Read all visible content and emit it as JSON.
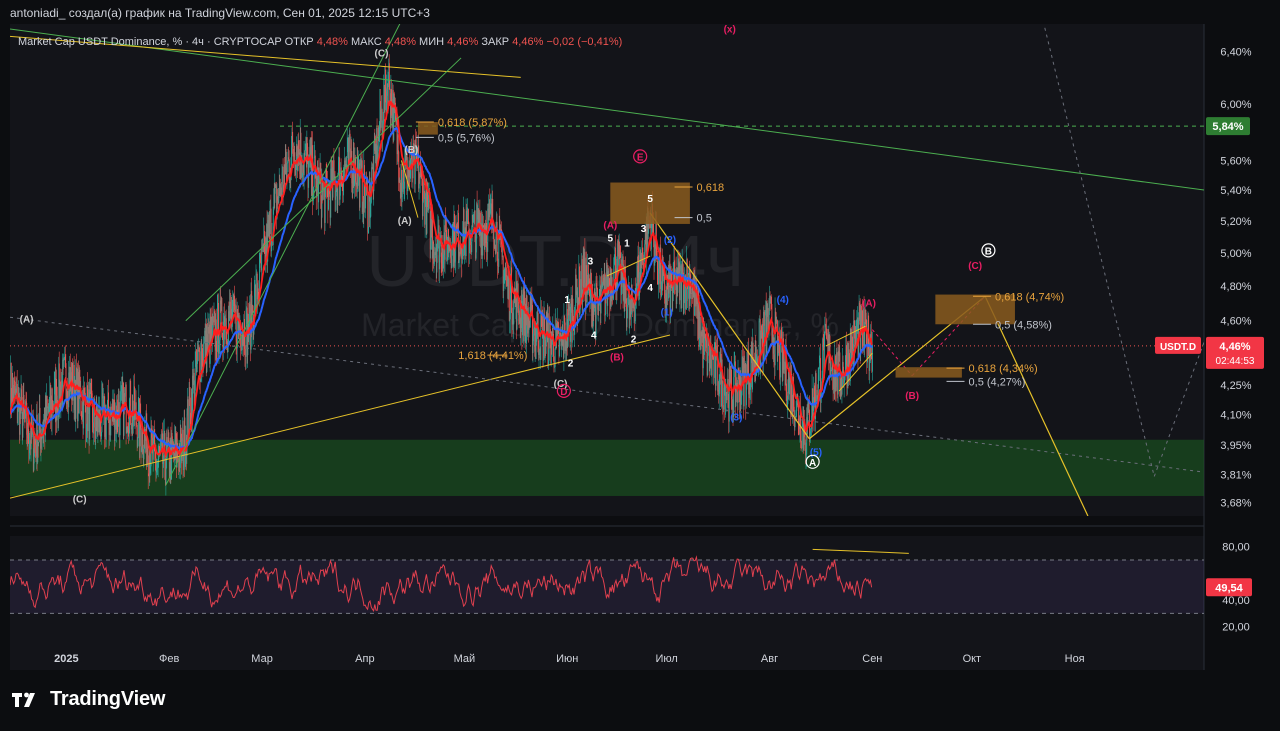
{
  "header": "antoniadi_ создал(а) график на TradingView.com, Сен 01, 2025 12:15 UTC+3",
  "legend": {
    "symbol": "Market Cap USDT Dominance, %",
    "interval": "4ч",
    "exchange": "CRYPTOCAP",
    "open_label": "ОТКР",
    "open": "4,48%",
    "high_label": "МАКС",
    "high": "4,48%",
    "low_label": "МИН",
    "low": "4,46%",
    "close_label": "ЗАКР",
    "close": "4,46%",
    "change": "−0,02 (−0,41%)"
  },
  "watermark": {
    "main": "USDT.D, 4ч",
    "sub": "Market Cap USDT Dominance, %"
  },
  "brand": "TradingView",
  "colors": {
    "background": "#0c0d10",
    "candle_up": "#26a69a",
    "candle_down": "#ef5350",
    "ema_fast": "#ff1e1e",
    "ema_slow": "#2962ff",
    "trendline": "#4caf50",
    "wave_line": "#e6c229",
    "fib_box": "#8a5a1e",
    "demand_zone": "#1b5e20",
    "rsi_line": "#e0404f",
    "price_tag": "#f23645",
    "level_tag": "#2e7d32"
  },
  "chart_data": [
    {
      "type": "candlestick",
      "title": "Market Cap USDT Dominance, %",
      "ylabel": "%",
      "y_scale": "log",
      "ylim": [
        3.62,
        6.62
      ],
      "y_ticks": [
        "6,40%",
        "6,00%",
        "5,60%",
        "5,40%",
        "5,20%",
        "5,00%",
        "4,80%",
        "4,60%",
        "4,25%",
        "4,10%",
        "3,95%",
        "3,81%",
        "3,68%"
      ],
      "x_ticks": [
        "2025",
        "Фев",
        "Мар",
        "Апр",
        "Май",
        "Июн",
        "Июл",
        "Авг",
        "Сен",
        "Окт",
        "Ноя"
      ],
      "x_dates": [
        "2025-01-01",
        "2025-02-01",
        "2025-03-01",
        "2025-04-01",
        "2025-05-01",
        "2025-06-01",
        "2025-07-01",
        "2025-08-01",
        "2025-09-01",
        "2025-10-01",
        "2025-11-01"
      ],
      "x_range": [
        "2024-12-15",
        "2025-12-10"
      ],
      "price_path": [
        [
          "2024-12-15",
          4.25
        ],
        [
          "2024-12-22",
          3.95
        ],
        [
          "2025-01-01",
          4.3
        ],
        [
          "2025-01-10",
          4.05
        ],
        [
          "2025-01-20",
          4.15
        ],
        [
          "2025-01-28",
          3.86
        ],
        [
          "2025-02-05",
          3.92
        ],
        [
          "2025-02-10",
          4.4
        ],
        [
          "2025-02-18",
          4.62
        ],
        [
          "2025-02-25",
          4.55
        ],
        [
          "2025-03-05",
          5.3
        ],
        [
          "2025-03-11",
          5.72
        ],
        [
          "2025-03-20",
          5.35
        ],
        [
          "2025-03-28",
          5.62
        ],
        [
          "2025-04-02",
          5.3
        ],
        [
          "2025-04-08",
          6.2
        ],
        [
          "2025-04-12",
          5.5
        ],
        [
          "2025-04-17",
          5.55
        ],
        [
          "2025-04-22",
          5.05
        ],
        [
          "2025-04-30",
          5.1
        ],
        [
          "2025-05-10",
          5.2
        ],
        [
          "2025-05-14",
          4.78
        ],
        [
          "2025-05-22",
          4.55
        ],
        [
          "2025-05-30",
          4.45
        ],
        [
          "2025-06-06",
          4.85
        ],
        [
          "2025-06-10",
          4.65
        ],
        [
          "2025-06-16",
          4.95
        ],
        [
          "2025-06-20",
          4.62
        ],
        [
          "2025-06-26",
          5.22
        ],
        [
          "2025-06-30",
          4.75
        ],
        [
          "2025-07-08",
          4.85
        ],
        [
          "2025-07-12",
          4.45
        ],
        [
          "2025-07-20",
          4.2
        ],
        [
          "2025-07-26",
          4.32
        ],
        [
          "2025-08-01",
          4.6
        ],
        [
          "2025-08-06",
          4.3
        ],
        [
          "2025-08-12",
          4.0
        ],
        [
          "2025-08-18",
          4.45
        ],
        [
          "2025-08-22",
          4.28
        ],
        [
          "2025-08-28",
          4.55
        ],
        [
          "2025-09-01",
          4.46
        ]
      ],
      "overlays": [
        {
          "name": "EMA fast",
          "color": "#ff1e1e"
        },
        {
          "name": "EMA slow",
          "color": "#2962ff"
        }
      ],
      "horizontal_levels": [
        {
          "value": 5.84,
          "label": "5,84%",
          "style": "dashed-green"
        },
        {
          "value": 4.46,
          "label": "4,46%",
          "style": "dashed-red"
        }
      ],
      "fib_levels": [
        {
          "label": "0,618 (5,87%)",
          "value": 5.87
        },
        {
          "label": "0,5 (5,76%)",
          "value": 5.76
        },
        {
          "label": "0,618",
          "value": 5.42
        },
        {
          "label": "0,5",
          "value": 5.22
        },
        {
          "label": "1,618 (4,41%)",
          "value": 4.41
        },
        {
          "label": "0,618 (4,74%)",
          "value": 4.74
        },
        {
          "label": "0,5 (4,58%)",
          "value": 4.58
        },
        {
          "label": "0,618 (4,34%)",
          "value": 4.34
        },
        {
          "label": "0,5 (4,27%)",
          "value": 4.27
        }
      ],
      "demand_zone": [
        3.71,
        3.975
      ],
      "last_price_tag": {
        "symbol": "USDT.D",
        "price": "4,46%",
        "countdown": "02:44:53"
      },
      "wave_labels": [
        {
          "text": "(A)",
          "date": "2024-12-20",
          "y": 4.59,
          "color": "#cccccc"
        },
        {
          "text": "(C)",
          "date": "2025-01-05",
          "y": 3.68,
          "color": "#cccccc"
        },
        {
          "text": "(C)",
          "date": "2025-04-06",
          "y": 6.36,
          "color": "#cccccc"
        },
        {
          "text": "(B)",
          "date": "2025-04-15",
          "y": 5.65,
          "color": "#cccccc"
        },
        {
          "text": "(A)",
          "date": "2025-04-13",
          "y": 5.18,
          "color": "#cccccc"
        },
        {
          "text": "(x)",
          "date": "2025-07-20",
          "y": 6.55,
          "color": "#e91e63"
        },
        {
          "text": "E",
          "date": "2025-06-23",
          "y": 5.6,
          "color": "#e91e63"
        },
        {
          "text": "5",
          "date": "2025-06-26",
          "y": 5.32,
          "color": "#ffffff"
        },
        {
          "text": "(A)",
          "date": "2025-06-14",
          "y": 5.15,
          "color": "#e91e63"
        },
        {
          "text": "5",
          "date": "2025-06-14",
          "y": 5.07,
          "color": "#ffffff"
        },
        {
          "text": "1",
          "date": "2025-06-19",
          "y": 5.04,
          "color": "#ffffff"
        },
        {
          "text": "3",
          "date": "2025-06-24",
          "y": 5.13,
          "color": "#ffffff"
        },
        {
          "text": "3",
          "date": "2025-06-08",
          "y": 4.93,
          "color": "#ffffff"
        },
        {
          "text": "1",
          "date": "2025-06-01",
          "y": 4.7,
          "color": "#ffffff"
        },
        {
          "text": "4",
          "date": "2025-06-09",
          "y": 4.5,
          "color": "#ffffff"
        },
        {
          "text": "4",
          "date": "2025-06-26",
          "y": 4.77,
          "color": "#ffffff"
        },
        {
          "text": "2",
          "date": "2025-06-21",
          "y": 4.48,
          "color": "#ffffff"
        },
        {
          "text": "2",
          "date": "2025-06-02",
          "y": 4.35,
          "color": "#ffffff"
        },
        {
          "text": "(2)",
          "date": "2025-07-02",
          "y": 5.06,
          "color": "#2962ff"
        },
        {
          "text": "(1)",
          "date": "2025-07-01",
          "y": 4.63,
          "color": "#2962ff"
        },
        {
          "text": "(B)",
          "date": "2025-06-16",
          "y": 4.38,
          "color": "#e91e63"
        },
        {
          "text": "(C)",
          "date": "2025-05-30",
          "y": 4.24,
          "color": "#cccccc"
        },
        {
          "text": "D",
          "date": "2025-05-31",
          "y": 4.2,
          "color": "#e91e63"
        },
        {
          "text": "(4)",
          "date": "2025-08-05",
          "y": 4.7,
          "color": "#2962ff"
        },
        {
          "text": "(3)",
          "date": "2025-07-22",
          "y": 4.07,
          "color": "#2962ff"
        },
        {
          "text": "(5)",
          "date": "2025-08-15",
          "y": 3.9,
          "color": "#2962ff"
        },
        {
          "text": "A",
          "date": "2025-08-14",
          "y": 3.85,
          "color": "#ffffff"
        },
        {
          "text": "(A)",
          "date": "2025-08-31",
          "y": 4.68,
          "color": "#e91e63"
        },
        {
          "text": "(B)",
          "date": "2025-09-13",
          "y": 4.18,
          "color": "#e91e63"
        },
        {
          "text": "(C)",
          "date": "2025-10-02",
          "y": 4.9,
          "color": "#e91e63"
        },
        {
          "text": "B",
          "date": "2025-10-06",
          "y": 4.99,
          "color": "#ffffff"
        }
      ],
      "grid": false
    },
    {
      "type": "line",
      "title": "RSI",
      "ylim": [
        10,
        88
      ],
      "y_ticks": [
        "80,00",
        "40,00",
        "20,00"
      ],
      "bands": [
        30,
        70
      ],
      "last_value": "49,54",
      "values_range": [
        12,
        80
      ]
    }
  ]
}
